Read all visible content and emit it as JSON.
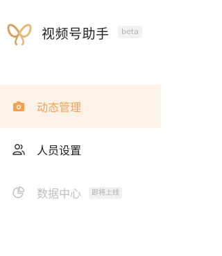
{
  "app": {
    "title": "视频号助手",
    "badge": "beta",
    "logo_icon": "butterfly-logo-icon",
    "brand_color": "#d8a25c"
  },
  "sidebar": {
    "accent_color": "#f2a153",
    "active_bg": "#fdf2e7",
    "items": [
      {
        "label": "动态管理",
        "icon": "camera-icon",
        "state": "active"
      },
      {
        "label": "人员设置",
        "icon": "users-icon",
        "state": "normal"
      },
      {
        "label": "数据中心",
        "icon": "pie-chart-icon",
        "state": "disabled",
        "badge": "即将上线"
      }
    ]
  }
}
